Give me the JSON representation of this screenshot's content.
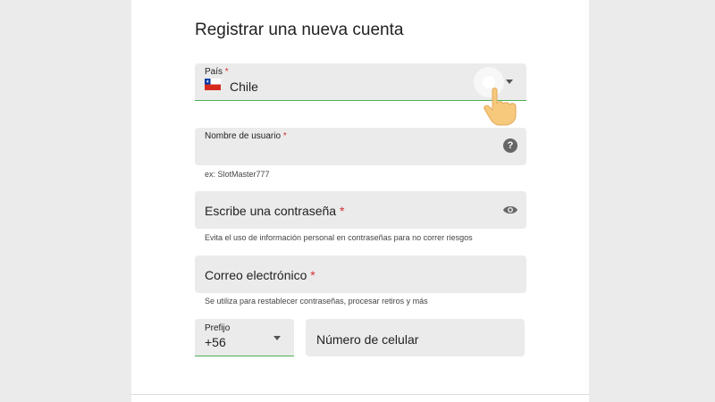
{
  "form": {
    "title": "Registrar una nueva cuenta",
    "required_mark": "*",
    "country": {
      "label": "País",
      "value": "Chile",
      "flag_icon": "chile-flag-icon"
    },
    "username": {
      "label": "Nombre de usuario",
      "hint": "ex: SlotMaster777",
      "help_icon": "help-icon"
    },
    "password": {
      "label": "Escribe una contraseña",
      "hint": "Evita el uso de información personal en contraseñas para no correr riesgos",
      "toggle_icon": "eye-icon"
    },
    "email": {
      "label": "Correo electrónico",
      "hint": "Se utiliza para restablecer contraseñas, procesar retiros y más"
    },
    "prefix": {
      "label": "Prefijo",
      "value": "+56"
    },
    "phone": {
      "placeholder": "Número de celular"
    }
  },
  "colors": {
    "accent": "#4caf50",
    "required": "#d32f2f",
    "field_bg": "#ebebeb"
  }
}
